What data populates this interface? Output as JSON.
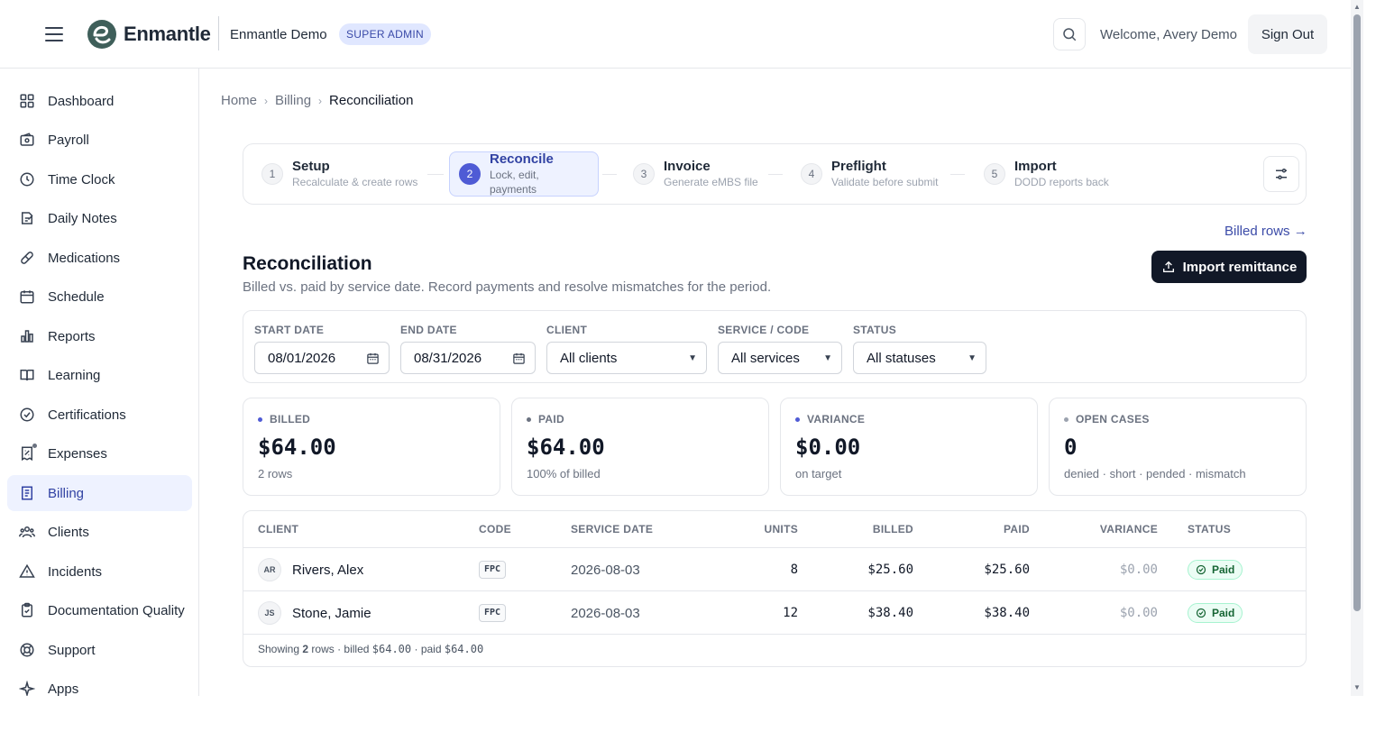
{
  "header": {
    "brand": "Enmantle",
    "org_name": "Enmantle Demo",
    "role_badge": "SUPER ADMIN",
    "welcome": "Welcome, Avery Demo",
    "sign_out": "Sign Out"
  },
  "sidebar": {
    "items": [
      {
        "label": "Dashboard",
        "icon": "grid-icon"
      },
      {
        "label": "Payroll",
        "icon": "wallet-icon"
      },
      {
        "label": "Time Clock",
        "icon": "clock-icon"
      },
      {
        "label": "Daily Notes",
        "icon": "notes-icon"
      },
      {
        "label": "Medications",
        "icon": "pill-icon"
      },
      {
        "label": "Schedule",
        "icon": "calendar-icon"
      },
      {
        "label": "Reports",
        "icon": "bar-chart-icon"
      },
      {
        "label": "Learning",
        "icon": "book-icon"
      },
      {
        "label": "Certifications",
        "icon": "check-circle-icon"
      },
      {
        "label": "Expenses",
        "icon": "receipt-icon"
      },
      {
        "label": "Billing",
        "icon": "document-icon",
        "active": true
      },
      {
        "label": "Clients",
        "icon": "users-icon"
      },
      {
        "label": "Incidents",
        "icon": "warning-icon"
      },
      {
        "label": "Documentation Quality",
        "icon": "clipboard-check-icon"
      },
      {
        "label": "Support",
        "icon": "lifebuoy-icon"
      },
      {
        "label": "Apps",
        "icon": "sparkle-icon"
      }
    ]
  },
  "breadcrumb": [
    "Home",
    "Billing",
    "Reconciliation"
  ],
  "stepper": {
    "steps": [
      {
        "num": "1",
        "title": "Setup",
        "sub": "Recalculate & create rows"
      },
      {
        "num": "2",
        "title": "Reconcile",
        "sub": "Lock, edit, payments",
        "active": true
      },
      {
        "num": "3",
        "title": "Invoice",
        "sub": "Generate eMBS file"
      },
      {
        "num": "4",
        "title": "Preflight",
        "sub": "Validate before submit"
      },
      {
        "num": "5",
        "title": "Import",
        "sub": "DODD reports back"
      }
    ]
  },
  "billed_rows_link": "Billed rows →",
  "page": {
    "title": "Reconciliation",
    "subtitle": "Billed vs. paid by service date. Record payments and resolve mismatches for the period.",
    "import_button": "Import remittance"
  },
  "filters": {
    "start_date": {
      "label": "START DATE",
      "value": "08/01/2026"
    },
    "end_date": {
      "label": "END DATE",
      "value": "08/31/2026"
    },
    "client": {
      "label": "CLIENT",
      "value": "All clients"
    },
    "service": {
      "label": "SERVICE / CODE",
      "value": "All services"
    },
    "status": {
      "label": "STATUS",
      "value": "All statuses"
    }
  },
  "cards": [
    {
      "label": "BILLED",
      "value": "$64.00",
      "sub": "2 rows",
      "dot_color": "#4f5bd5"
    },
    {
      "label": "PAID",
      "value": "$64.00",
      "sub": "100% of billed",
      "dot_color": "#6b7280"
    },
    {
      "label": "VARIANCE",
      "value": "$0.00",
      "sub": "on target",
      "dot_color": "#4f5bd5"
    },
    {
      "label": "OPEN CASES",
      "value": "0",
      "sub": "denied · short · pended · mismatch",
      "dot_color": "#9ca3af"
    }
  ],
  "table": {
    "columns": [
      "CLIENT",
      "CODE",
      "SERVICE DATE",
      "UNITS",
      "BILLED",
      "PAID",
      "VARIANCE",
      "STATUS"
    ],
    "rows": [
      {
        "initials": "AR",
        "client": "Rivers, Alex",
        "code": "FPC",
        "service_date": "2026-08-03",
        "units": "8",
        "billed": "$25.60",
        "paid": "$25.60",
        "variance": "$0.00",
        "status": "Paid"
      },
      {
        "initials": "JS",
        "client": "Stone, Jamie",
        "code": "FPC",
        "service_date": "2026-08-03",
        "units": "12",
        "billed": "$38.40",
        "paid": "$38.40",
        "variance": "$0.00",
        "status": "Paid"
      }
    ],
    "footer": {
      "prefix": "Showing",
      "count": "2",
      "rows_word": "rows · billed",
      "billed": "$64.00",
      "paid_word": "· paid",
      "paid": "$64.00"
    }
  },
  "colors": {
    "accent": "#4f5bd5",
    "brand_dark": "#111827",
    "paid_green": "#166534"
  }
}
